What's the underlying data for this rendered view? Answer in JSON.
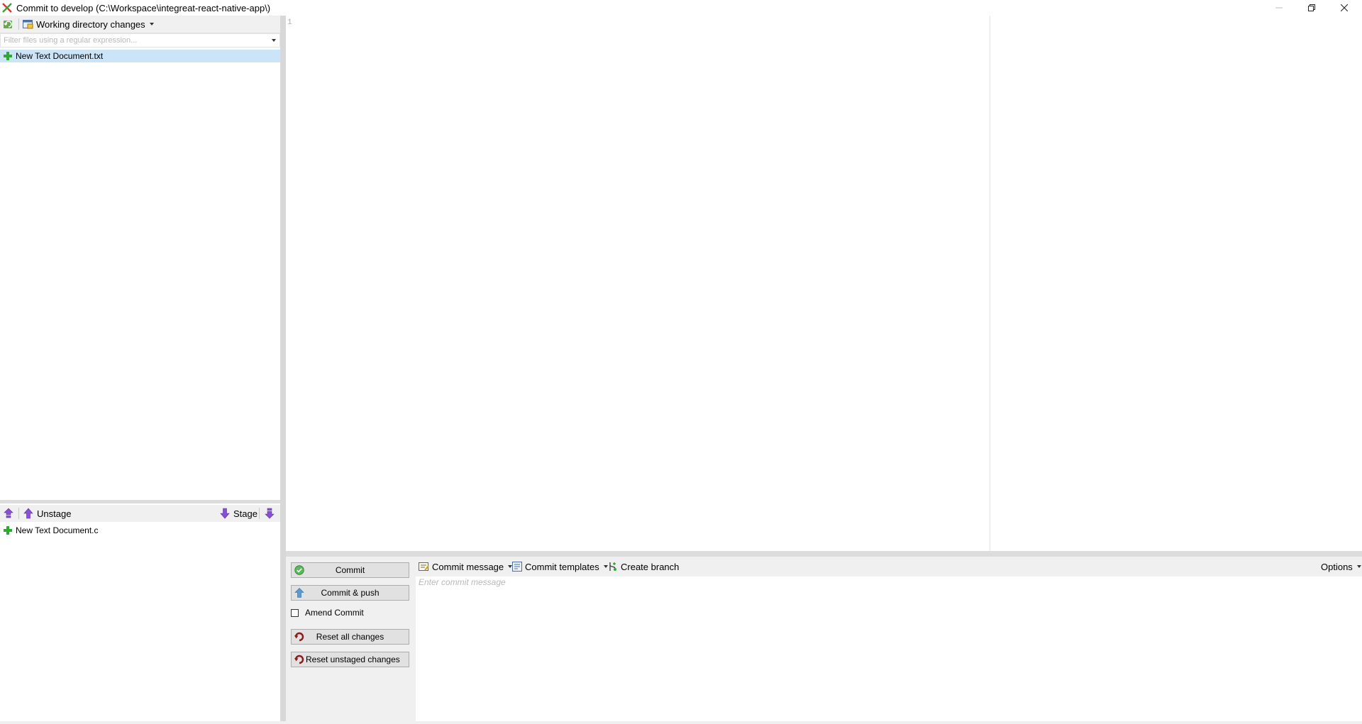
{
  "window": {
    "title": "Commit to develop (C:\\Workspace\\integreat-react-native-app\\)"
  },
  "left_toolbar": {
    "view_dropdown_label": "Working directory changes"
  },
  "filter": {
    "placeholder": "Filter files using a regular expression..."
  },
  "unstaged": {
    "files": [
      {
        "name": "New Text Document.txt",
        "status": "added"
      }
    ]
  },
  "staged_toolbar": {
    "unstage_label": "Unstage",
    "stage_label": "Stage"
  },
  "staged": {
    "files": [
      {
        "name": "New Text Document.c",
        "status": "added"
      }
    ]
  },
  "diff": {
    "line_numbers": [
      "1"
    ]
  },
  "commit_actions": {
    "commit_label": "Commit",
    "commit_push_label": "Commit & push",
    "amend_label": "Amend Commit",
    "amend_checked": false,
    "reset_all_label": "Reset all changes",
    "reset_unstaged_label": "Reset unstaged changes"
  },
  "message_toolbar": {
    "commit_message_label": "Commit message",
    "commit_templates_label": "Commit templates",
    "create_branch_label": "Create branch",
    "options_label": "Options"
  },
  "message": {
    "placeholder": "Enter commit message",
    "value": ""
  },
  "colors": {
    "selected_row": "#cce4f7",
    "add_green": "#2eaa2e",
    "stage_purple": "#8a4fd8",
    "reset_red": "#8b1a1a"
  }
}
